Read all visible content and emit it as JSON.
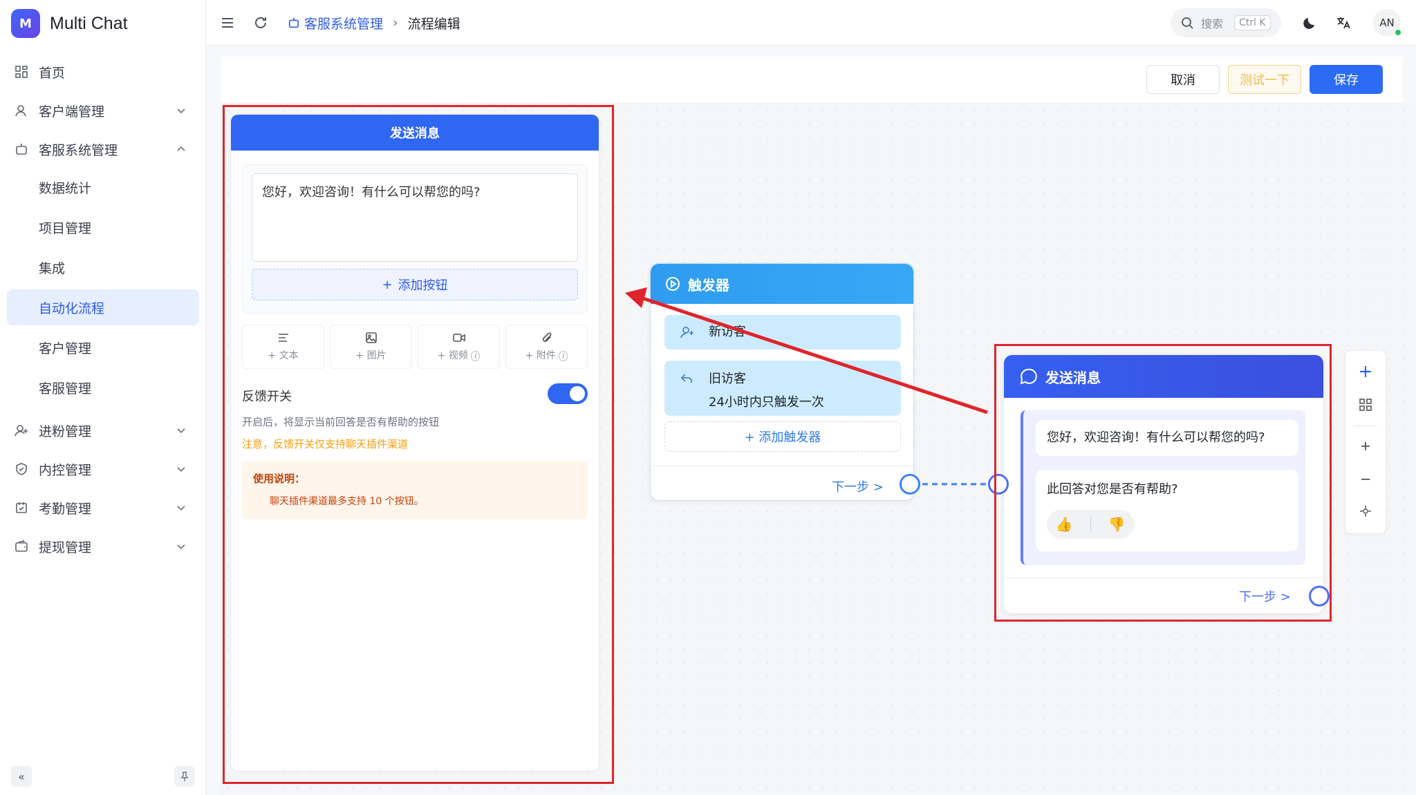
{
  "app": {
    "name": "Multi Chat",
    "logo_letter": "M"
  },
  "sidebar": {
    "items": [
      {
        "label": "首页",
        "icon": "dashboard-icon",
        "expandable": false
      },
      {
        "label": "客户端管理",
        "icon": "user-icon",
        "expandable": true
      },
      {
        "label": "客服系统管理",
        "icon": "robot-icon",
        "expandable": true,
        "expanded": true
      },
      {
        "label": "数据统计",
        "sub": true
      },
      {
        "label": "项目管理",
        "sub": true
      },
      {
        "label": "集成",
        "sub": true
      },
      {
        "label": "自动化流程",
        "sub": true,
        "active": true
      },
      {
        "label": "客户管理",
        "sub": true
      },
      {
        "label": "客服管理",
        "sub": true
      },
      {
        "label": "进粉管理",
        "icon": "user-plus-icon",
        "expandable": true
      },
      {
        "label": "内控管理",
        "icon": "shield-icon",
        "expandable": true
      },
      {
        "label": "考勤管理",
        "icon": "calendar-check-icon",
        "expandable": true
      },
      {
        "label": "提现管理",
        "icon": "wallet-icon",
        "expandable": true
      }
    ]
  },
  "header": {
    "breadcrumb": [
      "客服系统管理",
      "流程编辑"
    ],
    "search_placeholder": "搜索",
    "search_shortcut": "Ctrl K",
    "avatar": "AN"
  },
  "toolbar": {
    "cancel": "取消",
    "test": "测试一下",
    "save": "保存"
  },
  "editor": {
    "title": "发送消息",
    "message_text": "您好，欢迎咨询！有什么可以帮您的吗?",
    "add_button": "添加按钮",
    "types": [
      {
        "label": "+ 文本",
        "icon": "text-icon"
      },
      {
        "label": "+ 图片",
        "icon": "image-icon"
      },
      {
        "label": "+ 视频",
        "icon": "video-icon",
        "info": true
      },
      {
        "label": "+ 附件",
        "icon": "paperclip-icon",
        "info": true
      }
    ],
    "feedback_label": "反馈开关",
    "feedback_on": true,
    "feedback_desc": "开启后，将显示当前回答是否有帮助的按钮",
    "feedback_warn": "注意，反馈开关仅支持聊天插件渠道",
    "usage_title": "使用说明：",
    "usage_text": "聊天插件渠道最多支持 10 个按钮。"
  },
  "trigger_node": {
    "title": "触发器",
    "new_visitor": "新访客",
    "old_visitor": "旧访客",
    "old_visitor_note": "24小时内只触发一次",
    "add_trigger": "+ 添加触发器",
    "next": "下一步 >"
  },
  "send_node": {
    "title": "发送消息",
    "message": "您好，欢迎咨询！有什么可以帮您的吗?",
    "feedback_question": "此回答对您是否有帮助?",
    "thumbs_up": "👍",
    "thumbs_down": "👎",
    "next": "下一步 >"
  },
  "colors": {
    "accent": "#2f66f2",
    "highlight": "#e0242b",
    "trigger": "#2f9cf0"
  }
}
